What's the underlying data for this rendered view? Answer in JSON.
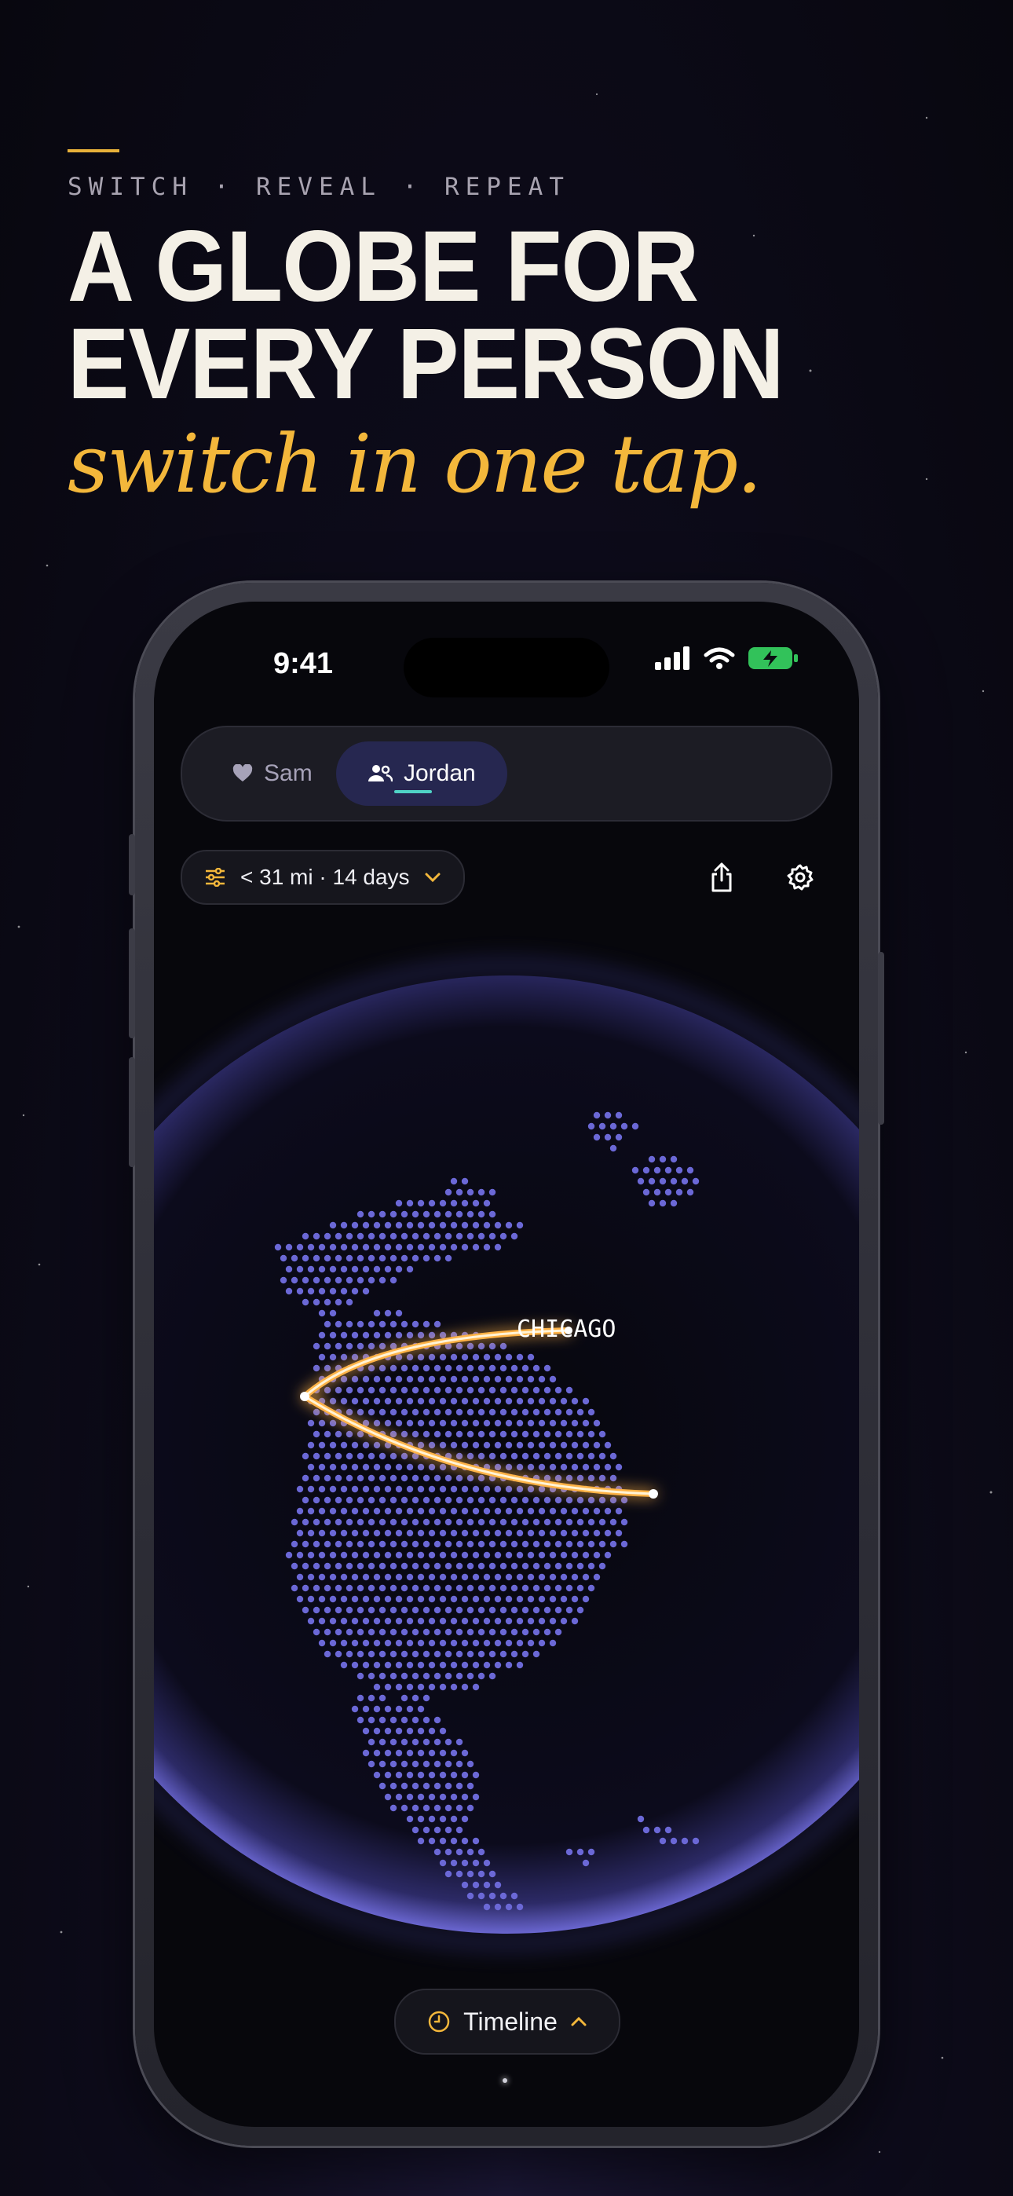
{
  "headline": {
    "eyebrow": "SWITCH · REVEAL · REPEAT",
    "title_line1": "A GLOBE FOR",
    "title_line2": "EVERY PERSON",
    "subtitle": "switch in one tap."
  },
  "status_bar": {
    "time": "9:41"
  },
  "profiles": [
    {
      "name": "Sam",
      "icon": "heart-icon",
      "selected": false
    },
    {
      "name": "Jordan",
      "icon": "people-icon",
      "selected": true
    }
  ],
  "filter": {
    "label": "< 31 mi · 14 days",
    "icon": "sliders-icon"
  },
  "actions": [
    {
      "icon": "share-icon"
    },
    {
      "icon": "gear-icon"
    }
  ],
  "map": {
    "city_label": "CHICAGO"
  },
  "timeline": {
    "label": "Timeline",
    "icon": "clock-icon"
  },
  "colors": {
    "accent": "#f3b73b",
    "globe_dots": "#6b68d6",
    "route": "#ffb347",
    "selected_pill": "#262750",
    "underline": "#4fd3c6"
  }
}
